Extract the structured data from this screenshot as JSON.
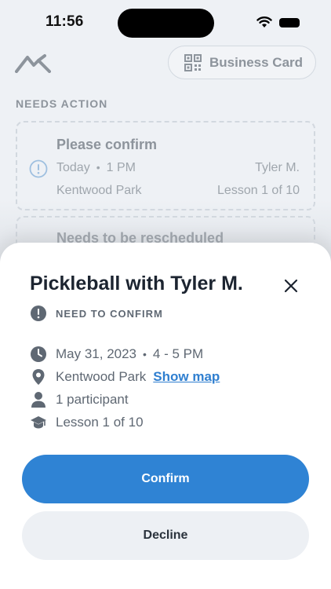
{
  "status_bar": {
    "time": "11:56"
  },
  "header": {
    "business_card_label": "Business Card"
  },
  "section": {
    "title": "NEEDS ACTION"
  },
  "cards": [
    {
      "title": "Please confirm",
      "day": "Today",
      "time": "1 PM",
      "person": "Tyler M.",
      "location": "Kentwood Park",
      "lesson": "Lesson 1 of 10"
    },
    {
      "title": "Needs to be rescheduled"
    }
  ],
  "sheet": {
    "title": "Pickleball with Tyler M.",
    "status": "NEED TO CONFIRM",
    "date": "May 31, 2023",
    "time_range": "4 - 5 PM",
    "location": "Kentwood Park",
    "show_map": "Show map",
    "participants": "1 participant",
    "lesson": "Lesson 1 of 10",
    "confirm_label": "Confirm",
    "decline_label": "Decline"
  },
  "separator": "•",
  "colors": {
    "accent": "#2f83d4",
    "link": "#2f7fd0",
    "text": "#1c2430",
    "muted": "#5f6873"
  },
  "icons": [
    "logo-icon",
    "qr-code-icon",
    "alert-icon",
    "close-icon",
    "clock-icon",
    "location-pin-icon",
    "person-icon",
    "graduation-cap-icon"
  ]
}
